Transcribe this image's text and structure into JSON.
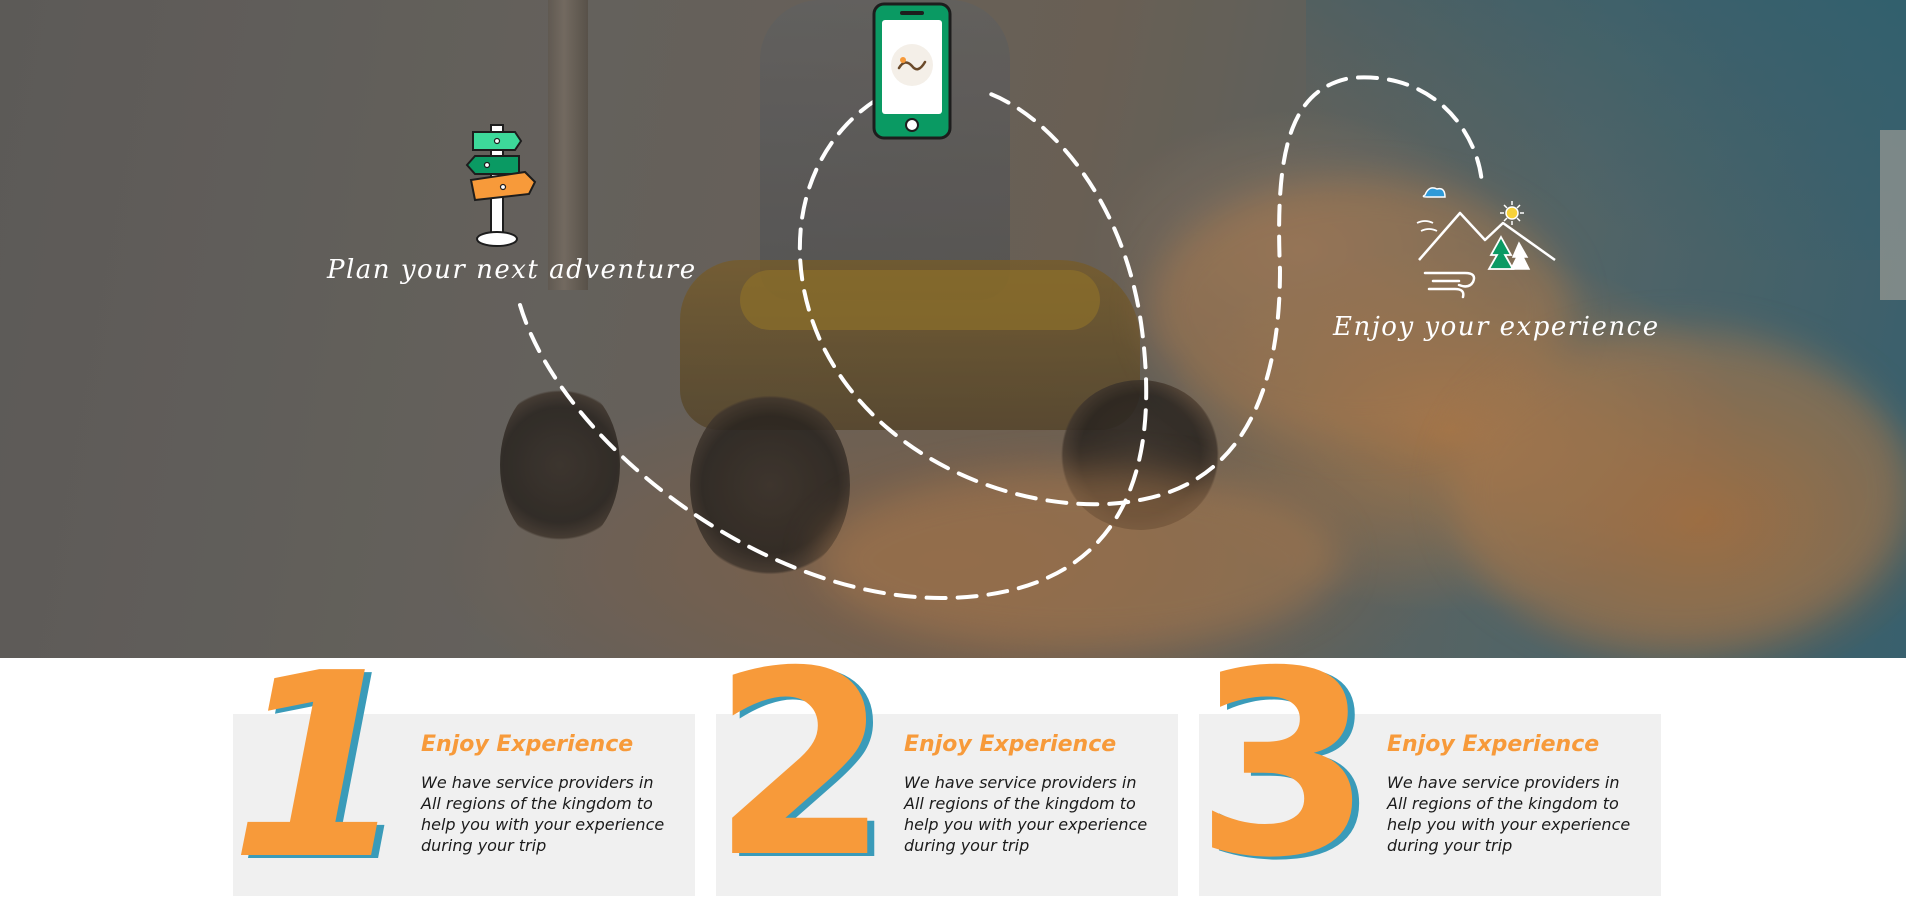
{
  "hero": {
    "step_plan_label": "Plan your next adventure",
    "step_enjoy_label": "Enjoy your experience",
    "icons": {
      "signpost": "signpost-icon",
      "phone": "phone-app-icon",
      "landscape": "mountain-landscape-icon"
    },
    "colors": {
      "route": "#ffffff",
      "green": "#0a9a63",
      "orange": "#f79a3a"
    }
  },
  "steps": {
    "items": [
      {
        "number": "1",
        "title": "Enjoy Experience",
        "description": "We have service providers in All regions of the kingdom to help you with your experience during your trip"
      },
      {
        "number": "2",
        "title": "Enjoy Experience",
        "description": "We have service providers in All regions of the kingdom to help you with your experience during your trip"
      },
      {
        "number": "3",
        "title": "Enjoy Experience",
        "description": "We have service providers in All regions of the kingdom to help you with your experience during your trip"
      }
    ],
    "colors": {
      "number": "#f79a3a",
      "number_shadow": "#3a9bb9",
      "title": "#f79a3a",
      "card_bg": "#f0f0f0"
    }
  }
}
